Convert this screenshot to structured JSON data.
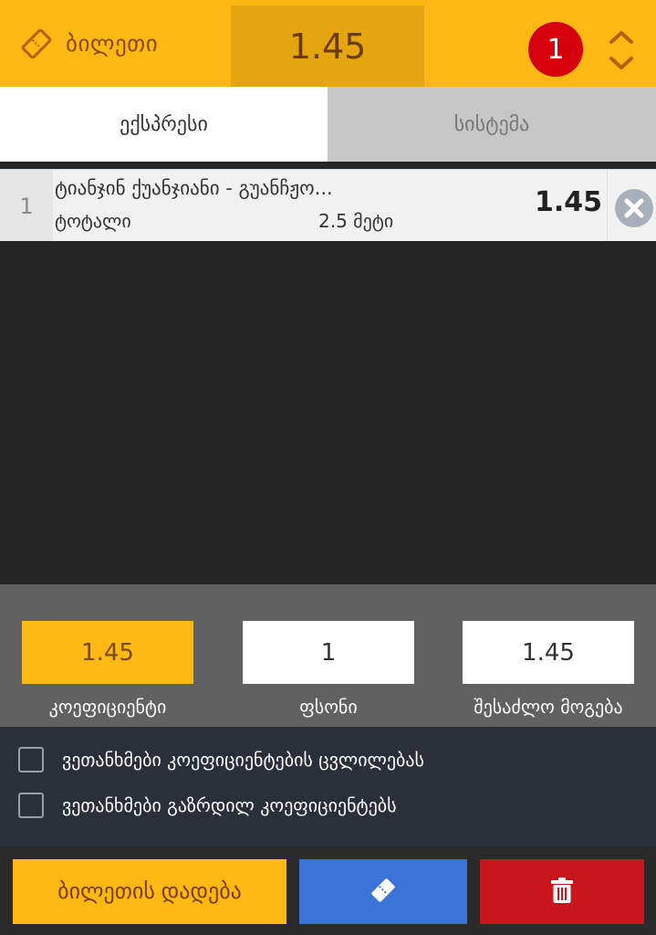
{
  "header": {
    "title": "ბილეთი",
    "total_odds": "1.45",
    "selection_count": "1"
  },
  "tabs": [
    {
      "label": "ექსპრესი",
      "active": true
    },
    {
      "label": "სისტემა",
      "active": false
    }
  ],
  "bets": [
    {
      "index": "1",
      "match": "ტიანჯინ ქუანჯიანი - გუანჩჟო...",
      "market": "ტოტალი",
      "pick": "2.5 მეტი",
      "odds": "1.45"
    }
  ],
  "stake_panel": {
    "coefficient_value": "1.45",
    "coefficient_label": "კოეფიციენტი",
    "stake_value": "1",
    "stake_label": "ფსონი",
    "win_value": "1.45",
    "win_label": "შესაძლო მოგება"
  },
  "options": [
    {
      "label": "ვეთანხმები კოეფიციენტების ცვლილებას",
      "checked": false
    },
    {
      "label": "ვეთანხმები გაზრდილ კოეფიციენტებს",
      "checked": false
    }
  ],
  "actions": {
    "place_label": "ბილეთის დადება",
    "ticket_icon": "ticket-icon",
    "delete_icon": "trash-icon"
  },
  "colors": {
    "accent": "#fdb813",
    "accent_dark": "#e5a50f",
    "badge": "#d6000c",
    "blue": "#3b73d9",
    "red": "#c8161c"
  }
}
